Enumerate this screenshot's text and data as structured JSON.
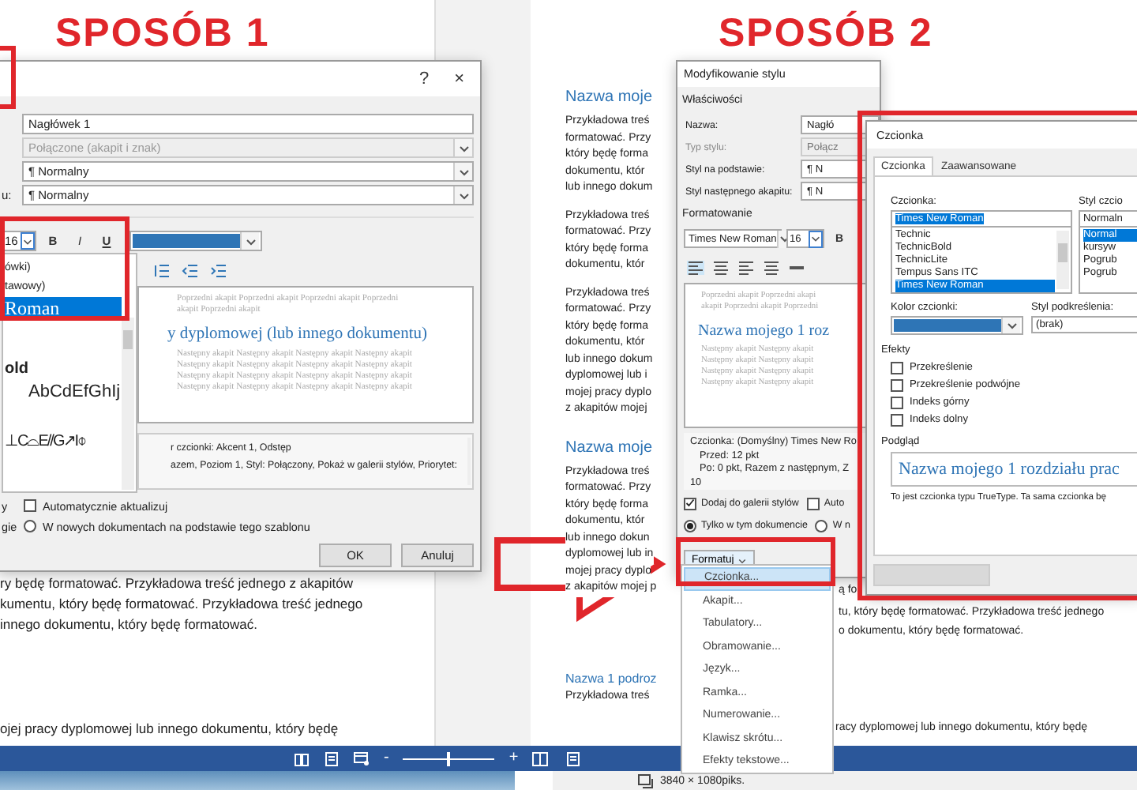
{
  "titles": [
    {
      "text": "SPOSÓB 1"
    },
    {
      "text": "SPOSÓB 2"
    }
  ],
  "left": {
    "dialog": {
      "help": "?",
      "close": "×",
      "fields": [
        {
          "value": "Nagłówek 1",
          "kind": "text",
          "disabled": false
        },
        {
          "value": "Połączone (akapit i znak)",
          "kind": "combo",
          "disabled": true
        },
        {
          "value": "¶ Normalny",
          "kind": "combo",
          "disabled": false
        },
        {
          "label": "u:",
          "value": "¶ Normalny",
          "kind": "combo",
          "disabled": false
        }
      ],
      "size": "16",
      "style_buttons": [
        "B",
        "I",
        "U"
      ],
      "font_list": [
        {
          "text": "ówki)",
          "kind": "name",
          "selected": false
        },
        {
          "text": "tawowy)",
          "kind": "name",
          "selected": false
        },
        {
          "text": "Roman",
          "kind": "name",
          "selected": true
        },
        {
          "text": "old",
          "kind": "bold",
          "selected": false
        },
        {
          "text": "AbCdEfGhIj",
          "kind": "sample",
          "selected": false
        },
        {
          "text": "⊥C⌓E//G↗I⌽",
          "kind": "symbol",
          "selected": false
        }
      ],
      "preview": {
        "previous": [
          "Poprzedni akapit Poprzedni akapit Poprzedni akapit Poprzedni",
          "akapit Poprzedni akapit"
        ],
        "heading": "y dyplomowej (lub innego dokumentu)",
        "next": [
          "Następny akapit Następny akapit Następny akapit Następny akapit",
          "Następny akapit Następny akapit Następny akapit Następny akapit",
          "Następny akapit Następny akapit Następny akapit Następny akapit",
          "Następny akapit Następny akapit Następny akapit Następny akapit"
        ]
      },
      "description": [
        "r czcionki: Akcent 1, Odstęp",
        "azem, Poziom 1, Styl: Połączony, Pokaż w galerii stylów, Priorytet:"
      ],
      "auto_update": {
        "prefix": "y",
        "label": "Automatycznie aktualizuj",
        "checked": false
      },
      "template_option": {
        "prefix": "gie",
        "label": "W nowych dokumentach na podstawie tego szablonu",
        "selected": false
      },
      "buttons": [
        "OK",
        "Anuluj"
      ]
    },
    "document": {
      "lines": [
        "ry będę formatować. Przykładowa treść jednego z akapitów",
        "kumentu, który będę formatować. Przykładowa treść jednego",
        "innego dokumentu, który będę formatować."
      ],
      "bottom_line": "ojej pracy dyplomowej lub innego dokumentu, który będę"
    },
    "status_bar": {
      "zoom_out": "-",
      "zoom_in": "+",
      "zoom": {
        "level": 0.48
      }
    }
  },
  "right": {
    "document": {
      "blocks": [
        {
          "kind": "heading",
          "lines": [
            "Nazwa moje"
          ]
        },
        {
          "kind": "body",
          "lines": [
            "Przykładowa treś",
            "formatować. Przy",
            "który będę forma",
            "dokumentu, któr",
            "lub innego dokum"
          ]
        },
        {
          "kind": "body",
          "lines": [
            "Przykładowa treś",
            "formatować. Przy",
            "który będę forma",
            "dokumentu, któr"
          ]
        },
        {
          "kind": "body",
          "lines": [
            "Przykładowa treś",
            "formatować. Przy",
            "który będę forma",
            "dokumentu, któr",
            "lub innego dokum",
            "dyplomowej lub i",
            "mojej pracy dyplo",
            "z akapitów mojej"
          ]
        },
        {
          "kind": "heading",
          "lines": [
            "Nazwa moje"
          ]
        },
        {
          "kind": "body",
          "lines": [
            "Przykładowa treś",
            "formatować. Przy",
            "który będę forma",
            "dokumentu, któr",
            "lub innego dokun",
            "dyplomowej lub in",
            "mojej pracy dyplo",
            "z akapitów mojej p"
          ]
        },
        {
          "kind": "subheading",
          "lines": [
            "Nazwa 1 podroz"
          ]
        },
        {
          "kind": "body",
          "lines": [
            "Przykładowa treś"
          ]
        }
      ],
      "side_lines": [
        "ą fo",
        "tu, który będę formatować. Przykładowa treść jednego",
        "o dokumentu, który będę formatować."
      ],
      "lower_line": "racy dyplomowej lub innego dokumentu, który będę"
    },
    "style_dialog": {
      "title": "Modyfikowanie stylu",
      "section": "Właściwości",
      "rows": [
        {
          "label": "Nazwa:",
          "value": "Nagłó",
          "disabled": false
        },
        {
          "label": "Typ stylu:",
          "value": "Połącz",
          "disabled": true
        },
        {
          "label": "Styl na podstawie:",
          "value": "¶ N",
          "disabled": false
        },
        {
          "label": "Styl następnego akapitu:",
          "value": "¶ N",
          "disabled": false
        }
      ],
      "format_section": "Formatowanie",
      "font": "Times New Roman",
      "size": "16",
      "bold": "B",
      "preview": {
        "previous": [
          "Poprzedni akapit Poprzedni akapi",
          "akapit Poprzedni akapit Poprzedni"
        ],
        "heading": "Nazwa mojego 1 roz",
        "next": [
          "Następny akapit Następny akapit",
          "Następny akapit Następny akapit",
          "Następny akapit Następny akapit",
          "Następny akapit Następny akapit"
        ]
      },
      "description": [
        "Czcionka: (Domyślny) Times New Ro",
        "Przed:  12 pkt",
        "Po:  0 pkt, Razem z następnym, Z",
        "10"
      ],
      "checks": [
        {
          "label": "Dodaj do galerii stylów",
          "checked": true
        },
        {
          "label": "Auto",
          "checked": false
        }
      ],
      "radios": [
        {
          "label": "Tylko w tym dokumencie",
          "selected": true
        },
        {
          "label": "W n",
          "selected": false
        }
      ]
    },
    "format_menu": {
      "button": "Formatuj",
      "items": [
        {
          "label": "Czcionka...",
          "selected": true
        },
        {
          "label": "Akapit...",
          "selected": false
        },
        {
          "label": "Tabulatory...",
          "selected": false
        },
        {
          "label": "Obramowanie...",
          "selected": false
        },
        {
          "label": "Język...",
          "selected": false
        },
        {
          "label": "Ramka...",
          "selected": false
        },
        {
          "label": "Numerowanie...",
          "selected": false
        },
        {
          "label": "Klawisz skrótu...",
          "selected": false
        },
        {
          "label": "Efekty tekstowe...",
          "selected": false
        }
      ]
    },
    "font_dialog": {
      "title": "Czcionka",
      "tabs": [
        {
          "label": "Czcionka",
          "selected": true
        },
        {
          "label": "Zaawansowane",
          "selected": false
        }
      ],
      "font_label": "Czcionka:",
      "font_value": "Times New Roman",
      "fonts": [
        {
          "label": "Technic",
          "selected": false
        },
        {
          "label": "TechnicBold",
          "selected": false
        },
        {
          "label": "TechnicLite",
          "selected": false
        },
        {
          "label": "Tempus Sans ITC",
          "selected": false
        },
        {
          "label": "Times New Roman",
          "selected": true
        }
      ],
      "style_label": "Styl czcio",
      "style_value": "Normaln",
      "styles": [
        {
          "label": "Normal",
          "selected": true
        },
        {
          "label": "kursyw",
          "selected": false
        },
        {
          "label": "Pogrub",
          "selected": false
        },
        {
          "label": "Pogrub",
          "selected": false
        }
      ],
      "color_label": "Kolor czcionki:",
      "underline_label": "Styl podkreślenia:",
      "underline_value": "(brak)",
      "effects_label": "Efekty",
      "effects": [
        {
          "label": "Przekreślenie",
          "checked": false
        },
        {
          "label": "Przekreślenie podwójne",
          "checked": false
        },
        {
          "label": "Indeks górny",
          "checked": false
        },
        {
          "label": "Indeks dolny",
          "checked": false
        }
      ],
      "preview_label": "Podgląd",
      "preview_text": "Nazwa mojego 1 rozdziału prac",
      "note": "To jest czcionka typu TrueType. Ta sama czcionka bę"
    },
    "status_bar": {
      "resolution": "3840 × 1080piks."
    }
  }
}
